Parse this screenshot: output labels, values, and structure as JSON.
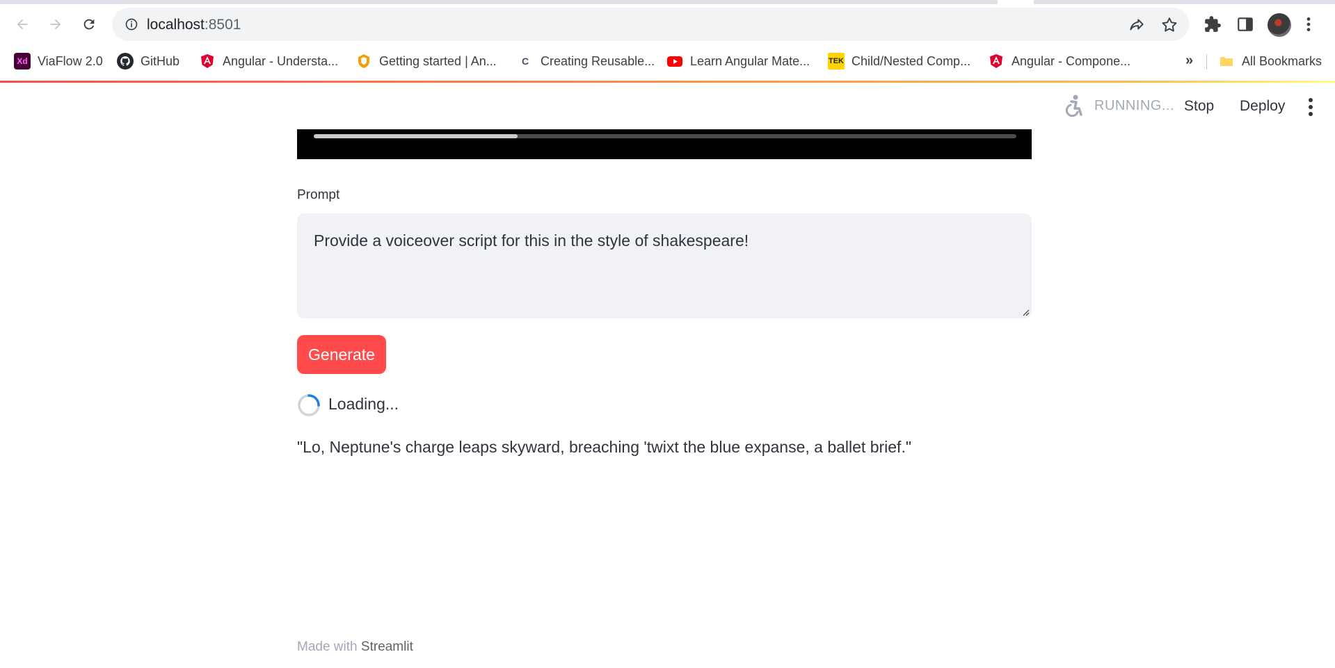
{
  "browser": {
    "url_host": "localhost",
    "url_port": ":8501",
    "bookmarks": [
      {
        "label": "ViaFlow 2.0",
        "icon": "adobe-xd-icon",
        "fav_text": "Xd",
        "color": "#470137"
      },
      {
        "label": "GitHub",
        "icon": "github-icon",
        "fav_text": "",
        "color": "#24292f"
      },
      {
        "label": "Angular - Understa...",
        "icon": "angular-icon",
        "fav_text": "",
        "color": "#dd0031"
      },
      {
        "label": "Getting started | An...",
        "icon": "shield-orange-icon",
        "fav_text": "",
        "color": "#f59e0b"
      },
      {
        "label": "Creating Reusable...",
        "icon": "c-logo-icon",
        "fav_text": "C",
        "color": "#4b4b7a"
      },
      {
        "label": "Learn Angular Mate...",
        "icon": "youtube-icon",
        "fav_text": "",
        "color": "#ff0000"
      },
      {
        "label": "Child/Nested Comp...",
        "icon": "tek-icon",
        "fav_text": "TEK",
        "color": "#ffd400"
      },
      {
        "label": "Angular - Compone...",
        "icon": "angular-icon",
        "fav_text": "",
        "color": "#dd0031"
      }
    ],
    "more_bookmarks": "»",
    "all_bookmarks": "All Bookmarks"
  },
  "header": {
    "status": "RUNNING...",
    "stop_label": "Stop",
    "deploy_label": "Deploy"
  },
  "video": {
    "progress": 0.29
  },
  "prompt": {
    "label": "Prompt",
    "value": "Provide a voiceover script for this in the style of shakespeare!"
  },
  "generate_label": "Generate",
  "loading_label": "Loading...",
  "result": "\"Lo, Neptune's charge leaps skyward, breaching 'twixt the blue expanse, a ballet brief.\"",
  "footer": {
    "prefix": "Made with",
    "brand": "Streamlit"
  },
  "colors": {
    "accent": "#ff4b4b",
    "text": "#31333f",
    "muted": "#a3a8b8",
    "input_bg": "#f0f2f6"
  }
}
